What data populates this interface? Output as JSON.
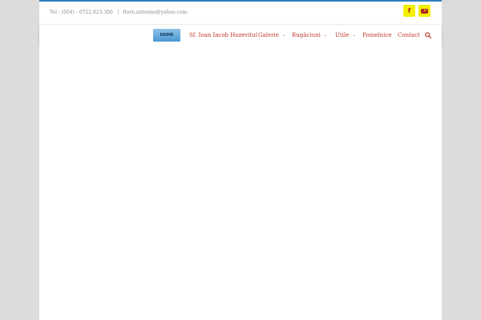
{
  "header": {
    "phone": "Tel : (004) - 0722.823.300",
    "email": "florn.antonne@yahoo.com"
  },
  "social": {
    "facebook_icon": "facebook-icon",
    "youtube_icon": "youtube-icon",
    "facebook_glyph": "f"
  },
  "nav": {
    "home": "HOME",
    "items": [
      {
        "label": "Sf. Ioan Iacob Hozevitul",
        "dropdown": false
      },
      {
        "label": "Galerie",
        "dropdown": true
      },
      {
        "label": "Rugăciuni",
        "dropdown": true
      },
      {
        "label": "Utile",
        "dropdown": true
      },
      {
        "label": "Pomelnice",
        "dropdown": false
      },
      {
        "label": "Contact",
        "dropdown": false
      }
    ],
    "caret": "⌄"
  },
  "colors": {
    "accent": "#2f7fbf",
    "nav_text": "#c0392b",
    "social_bg": "#f2ee00",
    "home_button": "#4a97d2"
  }
}
